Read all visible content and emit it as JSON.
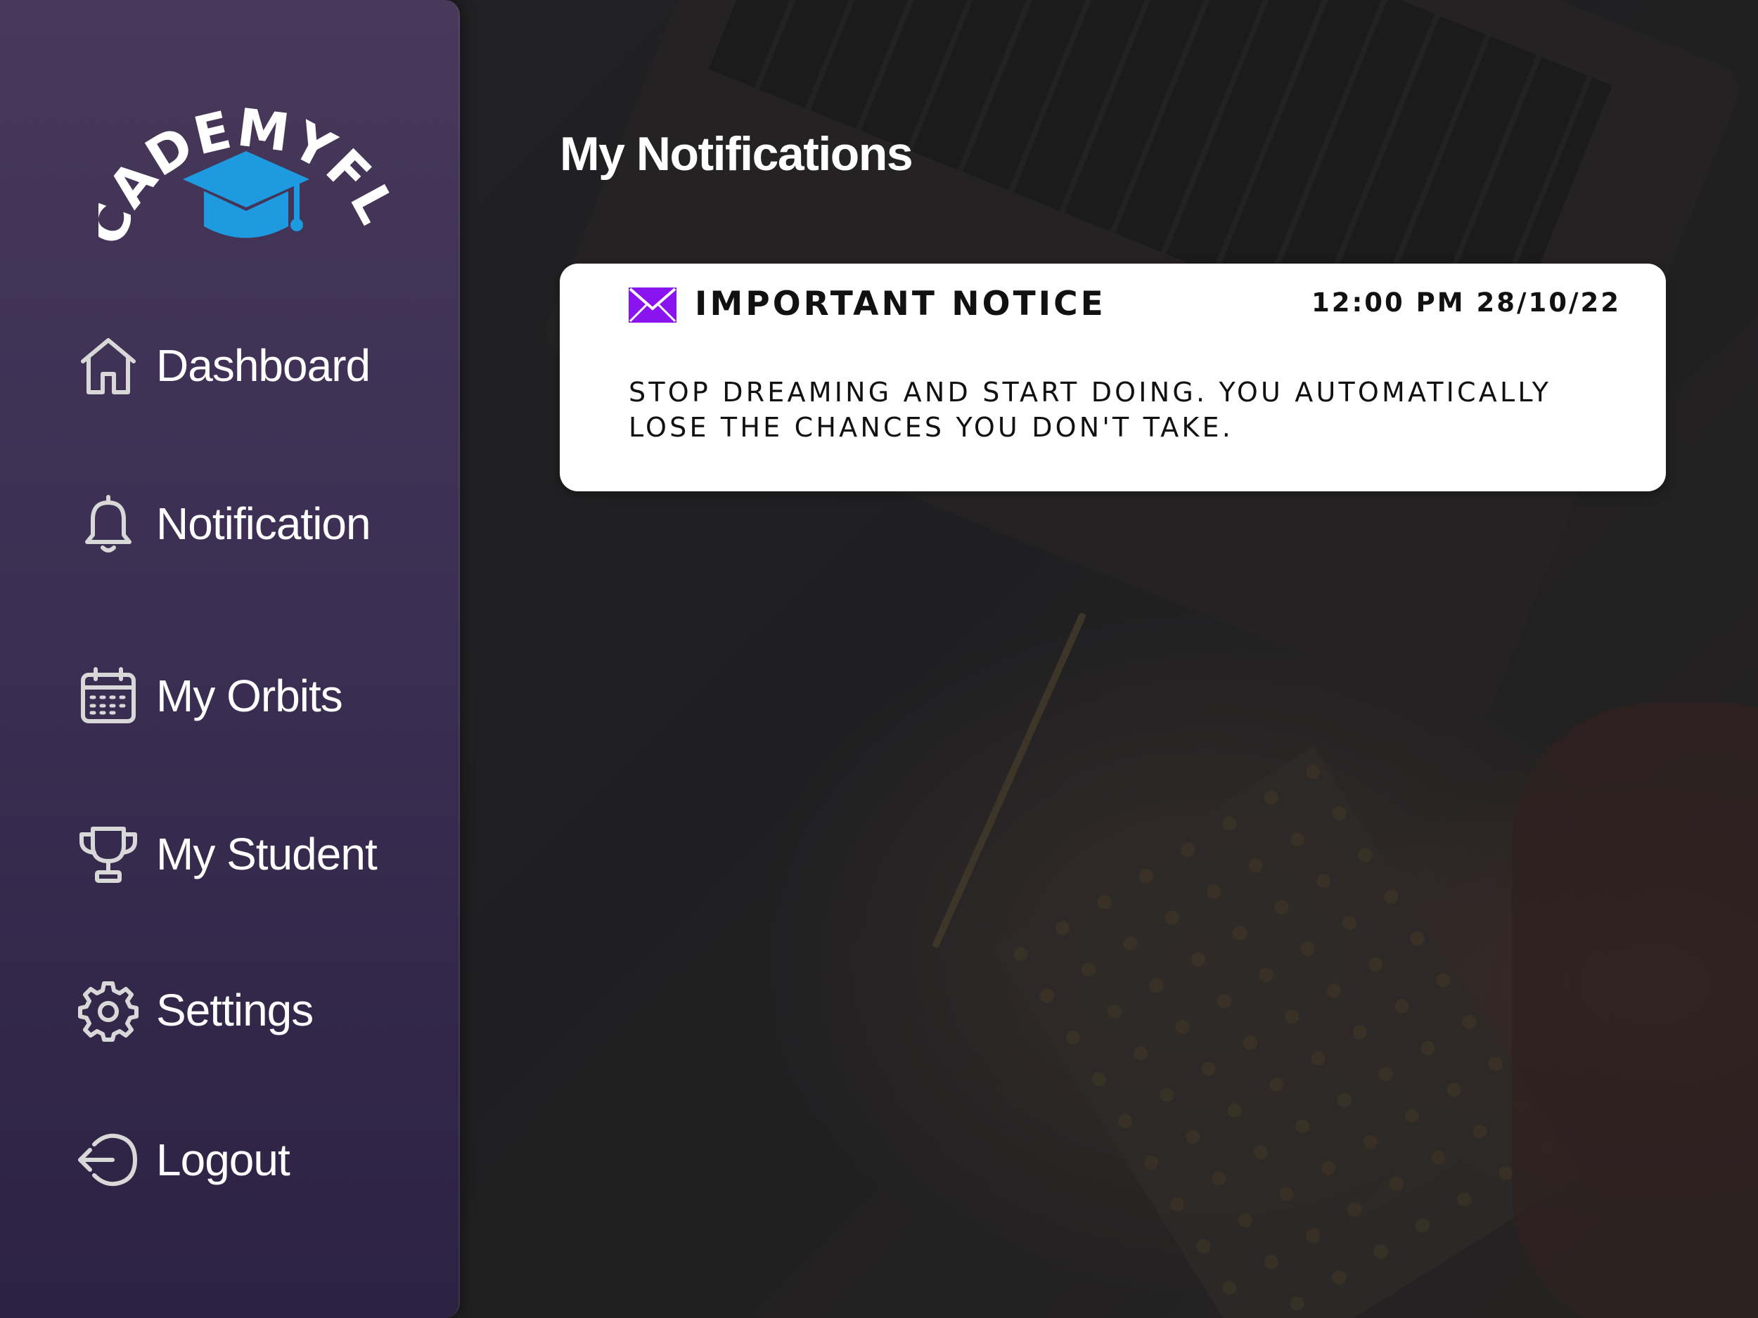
{
  "brand": {
    "name": "ACADEMYFLIX",
    "accent_color": "#1e9be0"
  },
  "sidebar": {
    "items": [
      {
        "label": "Dashboard",
        "icon": "home-icon"
      },
      {
        "label": "Notification",
        "icon": "bell-icon"
      },
      {
        "label": "My Orbits",
        "icon": "calendar-icon"
      },
      {
        "label": "My Student",
        "icon": "trophy-icon"
      },
      {
        "label": "Settings",
        "icon": "gear-icon"
      },
      {
        "label": "Logout",
        "icon": "logout-icon"
      }
    ]
  },
  "main": {
    "title": "My Notifications",
    "notifications": [
      {
        "icon": "envelope-icon",
        "icon_color": "#8a14f0",
        "title": "IMPORTANT NOTICE",
        "timestamp": "12:00 PM 28/10/22",
        "message": "STOP DREAMING AND START DOING. YOU AUTOMATICALLY LOSE THE CHANCES YOU DON'T TAKE."
      }
    ]
  }
}
